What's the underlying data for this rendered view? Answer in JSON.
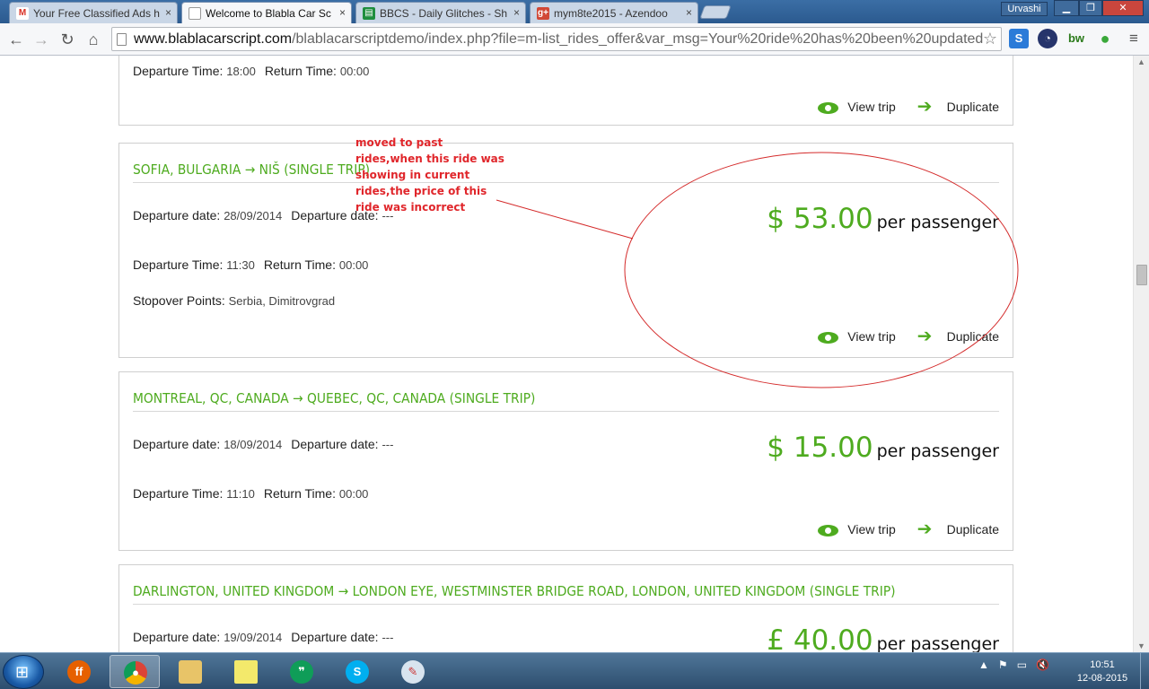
{
  "browser": {
    "tabs": [
      {
        "title": "Your Free Classified Ads h",
        "icon": "gmail-icon"
      },
      {
        "title": "Welcome to Blabla Car Sc",
        "icon": "page-icon"
      },
      {
        "title": "BBCS - Daily Glitches - Sh",
        "icon": "sheets-icon"
      },
      {
        "title": "mym8te2015 - Azendoo",
        "icon": "google-plus-icon"
      }
    ],
    "close_glyph": "×",
    "user": "Urvashi",
    "url_host": "www.blablacarscript.com",
    "url_path": "/blablacarscriptdemo/index.php?file=m-list_rides_offer&var_msg=Your%20ride%20has%20been%20updated",
    "extensions": [
      "skype-icon",
      "tachometer-icon",
      "bw",
      "evernote-icon"
    ]
  },
  "labels": {
    "departure_date": "Departure date:",
    "departure_time": "Departure Time:",
    "return_time": "Return Time:",
    "stopover": "Stopover Points:",
    "per_passenger": "per passenger",
    "view_trip": "View trip",
    "duplicate": "Duplicate"
  },
  "rides": [
    {
      "route": "",
      "departure_time": "18:00",
      "return_time": "00:00"
    },
    {
      "route": "SOFIA, BULGARIA → NIŠ (SINGLE TRIP)",
      "departure_date": "28/09/2014",
      "departure_date_2": "---",
      "price": "$ 53.00",
      "departure_time": "11:30",
      "return_time": "00:00",
      "stopover": "Serbia, Dimitrovgrad"
    },
    {
      "route": "MONTREAL, QC, CANADA → QUEBEC, QC, CANADA (SINGLE TRIP)",
      "departure_date": "18/09/2014",
      "departure_date_2": "---",
      "price": "$ 15.00",
      "departure_time": "11:10",
      "return_time": "00:00"
    },
    {
      "route": "DARLINGTON, UNITED KINGDOM → LONDON EYE, WESTMINSTER BRIDGE ROAD, LONDON, UNITED KINGDOM (SINGLE TRIP)",
      "departure_date": "19/09/2014",
      "departure_date_2": "---",
      "price": "£ 40.00"
    }
  ],
  "annotation": {
    "lines": [
      "moved to past",
      "rides,when this ride was",
      "showing in current",
      "rides,the price of this",
      "ride was incorrect"
    ],
    "color": "#e0262b"
  },
  "colors": {
    "accent": "#4eab1f"
  },
  "taskbar": {
    "apps": [
      "firefox-icon",
      "chrome-icon",
      "explorer-icon",
      "sticky-notes-icon",
      "hangouts-icon",
      "skype-icon",
      "paint-icon"
    ],
    "time": "10:51",
    "date": "12-08-2015"
  }
}
